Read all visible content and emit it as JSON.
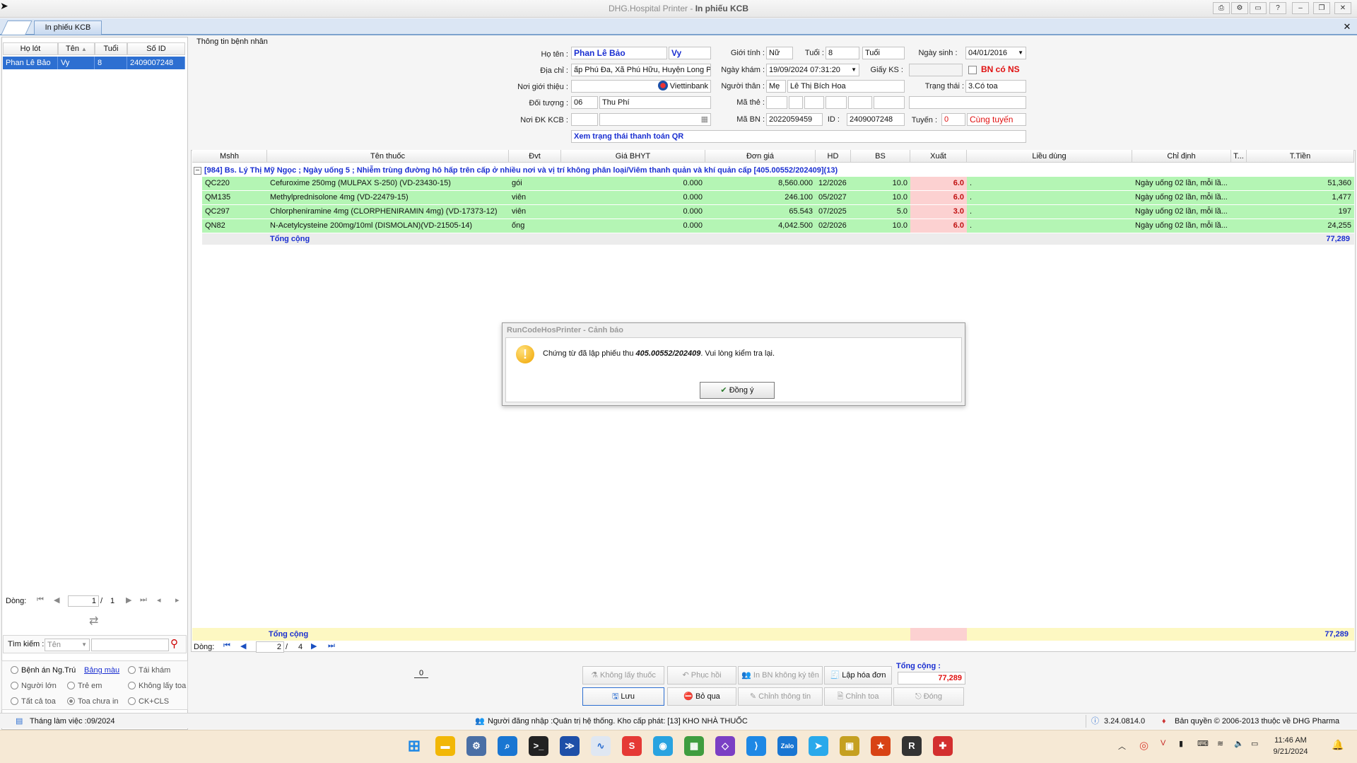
{
  "window": {
    "app": "DHG.Hospital Printer",
    "separator": " - ",
    "module": "In phiếu KCB",
    "tab_label": "In phiếu KCB"
  },
  "patient_list": {
    "headers": [
      "Họ lót",
      "Tên",
      "Tuổi",
      "Số ID"
    ],
    "rows": [
      [
        "Phan Lê Bảo",
        "Vy",
        "8",
        "2409007248"
      ]
    ],
    "pager": {
      "label": "Dòng:",
      "page": "1",
      "sep": "/",
      "total": "1"
    },
    "search": {
      "label": "Tìm kiếm :",
      "field": "Tên"
    }
  },
  "filters": {
    "row1": [
      "Bệnh án Ng.Trú",
      "Bảng màu",
      "Tái khám"
    ],
    "row2": [
      "Người lớn",
      "Trẻ em",
      "Không lấy toa"
    ],
    "row3": [
      "Tất cả toa",
      "Toa chưa in",
      "CK+CLS"
    ]
  },
  "form": {
    "section": "Thông tin bệnh nhân",
    "ho_ten_label": "Họ tên :",
    "ho_ten": "Phan Lê Bảo",
    "ten": "Vy",
    "gioi_tinh_label": "Giới tính :",
    "gioi_tinh": "Nữ",
    "tuoi_label": "Tuổi :",
    "tuoi": "8",
    "tuoi_unit": "Tuổi",
    "ngay_sinh_label": "Ngày sinh :",
    "ngay_sinh": "04/01/2016",
    "dia_chi_label": "Địa chỉ :",
    "dia_chi": "ấp Phú Đa, Xã Phú Hữu, Huyện Long Ph",
    "ngay_kham_label": "Ngày khám :",
    "ngay_kham": "19/09/2024 07:31:20",
    "giay_ks_label": "Giấy KS :",
    "bn_co_ns": "BN có NS",
    "noi_gioi_thieu_label": "Nơi giới thiệu :",
    "bank": "Viettinbank",
    "nguoi_than_label": "Người thân :",
    "nguoi_than_rel": "Mẹ",
    "nguoi_than": "Lê Thị Bích Hoa",
    "trang_thai_label": "Trạng thái :",
    "trang_thai": "3.Có toa",
    "doi_tuong_label": "Đối tượng :",
    "doi_tuong_code": "06",
    "doi_tuong": "Thu Phí",
    "ma_the_label": "Mã thẻ :",
    "noi_dk_label": "Nơi ĐK KCB :",
    "ma_bn_label": "Mã BN :",
    "ma_bn": "2022059459",
    "id_label": "ID :",
    "id": "2409007248",
    "tuyen_label": "Tuyến :",
    "tuyen_code": "0",
    "tuyen": "Cùng tuyến",
    "qr_link": "Xem trạng thái thanh toán QR"
  },
  "grid": {
    "headers": [
      "Mshh",
      "Tên thuốc",
      "Đvt",
      "Giá BHYT",
      "Đơn giá",
      "HD",
      "BS",
      "Xuất",
      "Liều dùng",
      "Chỉ định",
      "T...",
      "T.Tiền"
    ],
    "group": "[984] Bs. Lý Thị Mỹ Ngọc ; Ngày uống 5 ; Nhiễm trùng đường hô hấp trên cấp ở nhiều nơi và vị trí không phân loại/Viêm thanh quản và khí quản cấp [405.00552/202409](13)",
    "group_toggle": "−",
    "rows": [
      {
        "mshh": "QC220",
        "ten": "Cefuroxime 250mg (MULPAX S-250) (VD-23430-15)",
        "dvt": "gói",
        "gia_bhyt": "0.000",
        "don_gia": "8,560.000",
        "hd": "12/2026",
        "bs": "10.0",
        "xuat": "6.0",
        "lieu": ".",
        "chi_dinh": "Ngày uống 02 lần, mỗi lầ...",
        "t": "",
        "tien": "51,360"
      },
      {
        "mshh": "QM135",
        "ten": "Methylprednisolone 4mg (VD-22479-15)",
        "dvt": "viên",
        "gia_bhyt": "0.000",
        "don_gia": "246.100",
        "hd": "05/2027",
        "bs": "10.0",
        "xuat": "6.0",
        "lieu": ".",
        "chi_dinh": "Ngày uống 02 lần, mỗi lầ...",
        "t": "",
        "tien": "1,477"
      },
      {
        "mshh": "QC297",
        "ten": "Chlorpheniramine 4mg (CLORPHENIRAMIN 4mg) (VD-17373-12)",
        "dvt": "viên",
        "gia_bhyt": "0.000",
        "don_gia": "65.543",
        "hd": "07/2025",
        "bs": "5.0",
        "xuat": "3.0",
        "lieu": ".",
        "chi_dinh": "Ngày uống 02 lần, mỗi lầ...",
        "t": "",
        "tien": "197"
      },
      {
        "mshh": "QN82",
        "ten": "N-Acetylcysteine 200mg/10ml (DISMOLAN)(VD-21505-14)",
        "dvt": "ống",
        "gia_bhyt": "0.000",
        "don_gia": "4,042.500",
        "hd": "02/2026",
        "bs": "10.0",
        "xuat": "6.0",
        "lieu": ".",
        "chi_dinh": "Ngày uống 02 lần, mỗi lầ...",
        "t": "",
        "tien": "24,255"
      }
    ],
    "total_label": "Tổng cộng",
    "total": "77,289",
    "pager": {
      "label": "Dòng:",
      "page": "2",
      "sep": "/",
      "total": "4"
    }
  },
  "dialog": {
    "title": "RunCodeHosPrinter - Cảnh báo",
    "msg_pre": "Chứng từ đã lập phiếu thu ",
    "msg_code": "405.00552/202409",
    "msg_post": ". Vui lòng kiểm tra lại.",
    "ok": "Đồng ý"
  },
  "actions": {
    "counter": "0",
    "khong_lay_thuoc": "Không lấy thuốc",
    "phuc_hoi": "Phục hồi",
    "in_bn": "In BN không ký tên",
    "lap_hoa_don": "Lập hóa đơn",
    "luu": "Lưu",
    "bo_qua": "Bỏ qua",
    "chinh_thong_tin": "Chỉnh thông tin",
    "chinh_toa": "Chỉnh toa",
    "dong": "Đóng",
    "tong_cong_label": "Tổng cộng :",
    "tong_cong": "77,289"
  },
  "status": {
    "thang": "Tháng làm việc :09/2024",
    "user": "Người đăng nhập :Quản trị hệ thống. Kho cấp phát: [13] KHO NHÀ THUỐC",
    "version": "3.24.0814.0",
    "copyright": "Bản quyền © 2006-2013 thuộc về DHG Pharma"
  },
  "taskbar": {
    "time": "11:46 AM",
    "date": "9/21/2024"
  },
  "colors": {
    "accent": "#2d6fd1",
    "row_green": "#b4f5b4",
    "xuat_pink": "#fcd1d1",
    "link_blue": "#1a2fd1",
    "red": "#e01010"
  }
}
